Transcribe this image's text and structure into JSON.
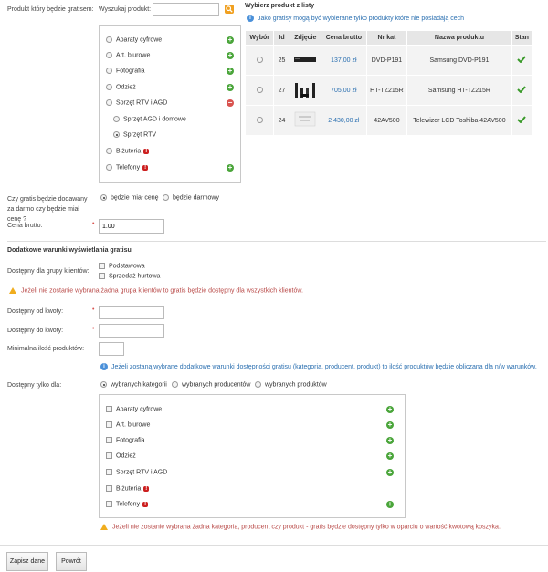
{
  "product_select": {
    "label": "Produkt który będzie gratisem:",
    "search_label": "Wyszukaj produkt:",
    "search_value": ""
  },
  "category_tree": [
    {
      "label": "Aparaty cyfrowe",
      "badge": false,
      "action": "plus"
    },
    {
      "label": "Art. biurowe",
      "badge": false,
      "action": "plus"
    },
    {
      "label": "Fotografia",
      "badge": false,
      "action": "plus"
    },
    {
      "label": "Odzież",
      "badge": false,
      "action": "plus"
    },
    {
      "label": "Sprzęt RTV i AGD",
      "badge": false,
      "action": "minus"
    },
    {
      "label": "Sprzęt AGD i domowe",
      "badge": false,
      "action": "none",
      "child": true
    },
    {
      "label": "Sprzęt RTV",
      "badge": false,
      "action": "none",
      "child": true,
      "selected": true
    },
    {
      "label": "Biżuteria",
      "badge": true,
      "action": "none"
    },
    {
      "label": "Telefony",
      "badge": true,
      "action": "plus"
    }
  ],
  "product_list": {
    "title": "Wybierz produkt z listy",
    "info": "Jako gratisy mogą być wybierane tylko produkty które nie posiadają cech",
    "headers": [
      "Wybór",
      "Id",
      "Zdjęcie",
      "Cena brutto",
      "Nr kat",
      "Nazwa produktu",
      "Stan"
    ],
    "rows": [
      {
        "id": "25",
        "price": "137,00 zł",
        "sku": "DVD-P191",
        "name": "Samsung DVD-P191"
      },
      {
        "id": "27",
        "price": "705,00 zł",
        "sku": "HT-TZ215R",
        "name": "Samsung HT-TZ215R"
      },
      {
        "id": "24",
        "price": "2 430,00 zł",
        "sku": "42AV500",
        "name": "Telewizor LCD Toshiba 42AV500"
      }
    ]
  },
  "price_mode": {
    "label": "Czy gratis będzie dodawany za darmo czy będzie miał cenę ?",
    "opt_paid": "będzie miał cenę",
    "opt_free": "będzie darmowy"
  },
  "gross_price": {
    "label": "Cena brutto:",
    "value": "1.00"
  },
  "extra_section": {
    "title": "Dodatkowe warunki wyświetlania gratisu"
  },
  "client_groups": {
    "label": "Dostępny dla grupy klientów:",
    "options": [
      "Podstawowa",
      "Sprzedaż hurtowa"
    ],
    "warning": "Jeżeli nie zostanie wybrana żadna grupa klientów to gratis będzie dostępny dla wszystkich klientów."
  },
  "amount_from": {
    "label": "Dostępny od kwoty:",
    "value": ""
  },
  "amount_to": {
    "label": "Dostępny do kwoty:",
    "value": ""
  },
  "min_qty": {
    "label": "Minimalna ilość produktów:",
    "value": ""
  },
  "extra_info": "Jeżeli zostaną wybrane dodatkowe warunki dostępności gratisu (kategoria, producent, produkt) to ilość produktów będzie obliczana dla n/w warunków.",
  "available_for": {
    "label": "Dostępny tylko dla:",
    "opt_categories": "wybranych kategorii",
    "opt_producers": "wybranych producentów",
    "opt_products": "wybranych produktów"
  },
  "category_checks": [
    {
      "label": "Aparaty cyfrowe",
      "badge": false,
      "plus": true
    },
    {
      "label": "Art. biurowe",
      "badge": false,
      "plus": true
    },
    {
      "label": "Fotografia",
      "badge": false,
      "plus": true
    },
    {
      "label": "Odzież",
      "badge": false,
      "plus": true
    },
    {
      "label": "Sprzęt RTV i AGD",
      "badge": false,
      "plus": true
    },
    {
      "label": "Biżuteria",
      "badge": true,
      "plus": false
    },
    {
      "label": "Telefony",
      "badge": true,
      "plus": true
    }
  ],
  "bottom_warning": "Jeżeli nie zostanie wybrana żadna kategoria, producent czy produkt - gratis będzie dostępny tylko w oparciu o wartość kwotową koszyka.",
  "buttons": {
    "save": "Zapisz dane",
    "back": "Powrót"
  },
  "colors": {
    "accent": "#2a6fb0",
    "warning": "#b94a48",
    "ok": "#4aa53a"
  }
}
